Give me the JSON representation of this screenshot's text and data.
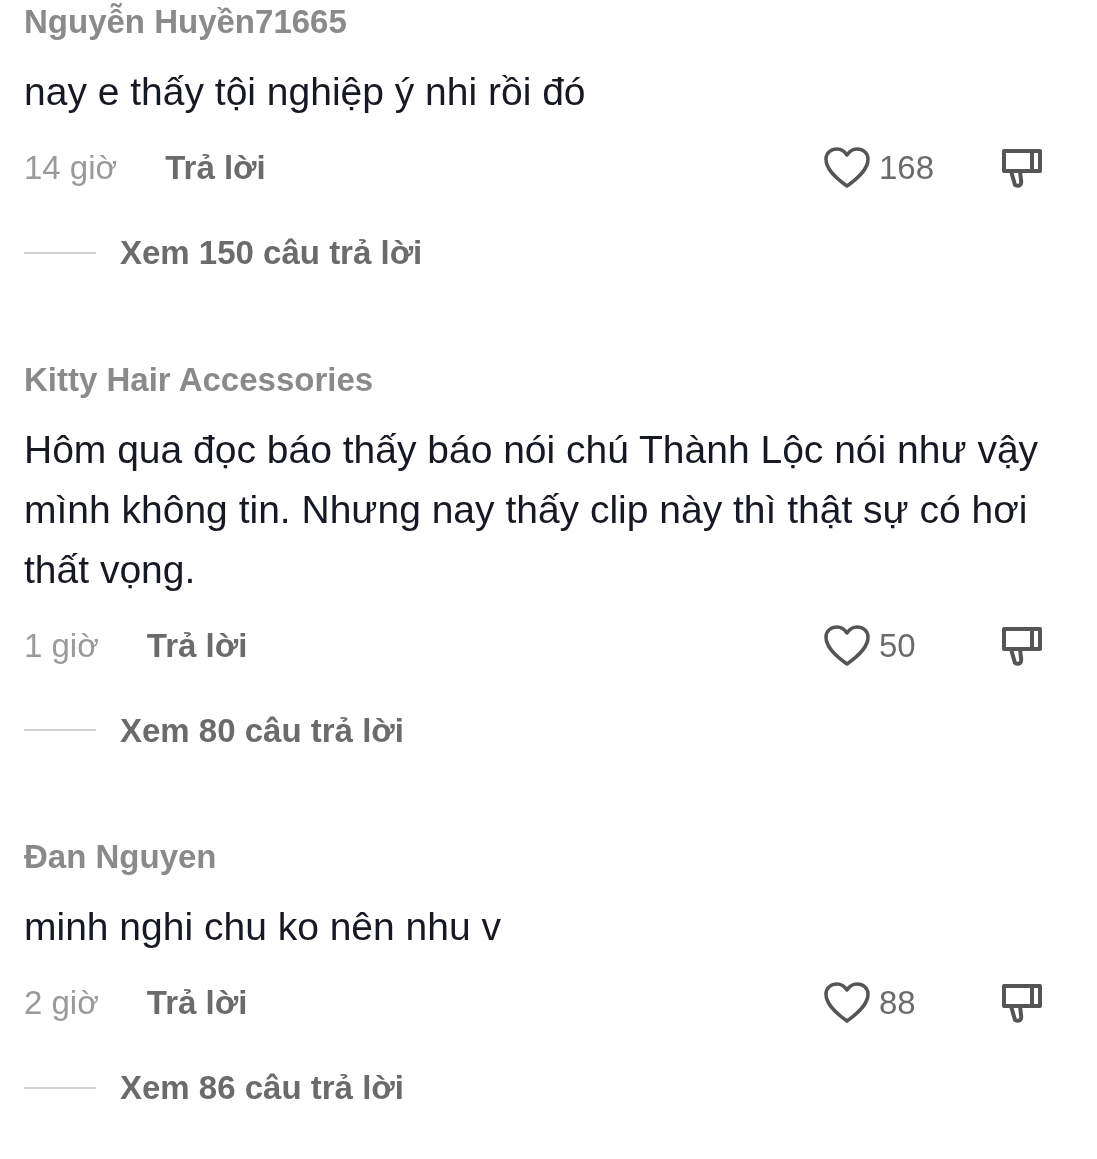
{
  "comments": [
    {
      "username": "Nguyễn Huyền71665",
      "text": "nay e thấy tội nghiệp ý nhi rồi đó",
      "time": "14 giờ",
      "reply_label": "Trả lời",
      "likes": "168",
      "liked": false,
      "view_replies": "Xem 150 câu trả lời"
    },
    {
      "username": "Kitty Hair Accessories",
      "text": "Hôm qua đọc báo thấy báo nói chú Thành Lộc nói như vậy mình không tin. Nhưng nay thấy clip này thì thật sự có hơi thất vọng.",
      "time": "1 giờ",
      "reply_label": "Trả lời",
      "likes": "50",
      "liked": false,
      "view_replies": "Xem 80 câu trả lời"
    },
    {
      "username": "Đan Nguyen",
      "text": "minh nghi chu ko nên nhu v",
      "time": "2 giờ",
      "reply_label": "Trả lời",
      "likes": "88",
      "liked": false,
      "view_replies": "Xem 86 câu trả lời"
    }
  ]
}
